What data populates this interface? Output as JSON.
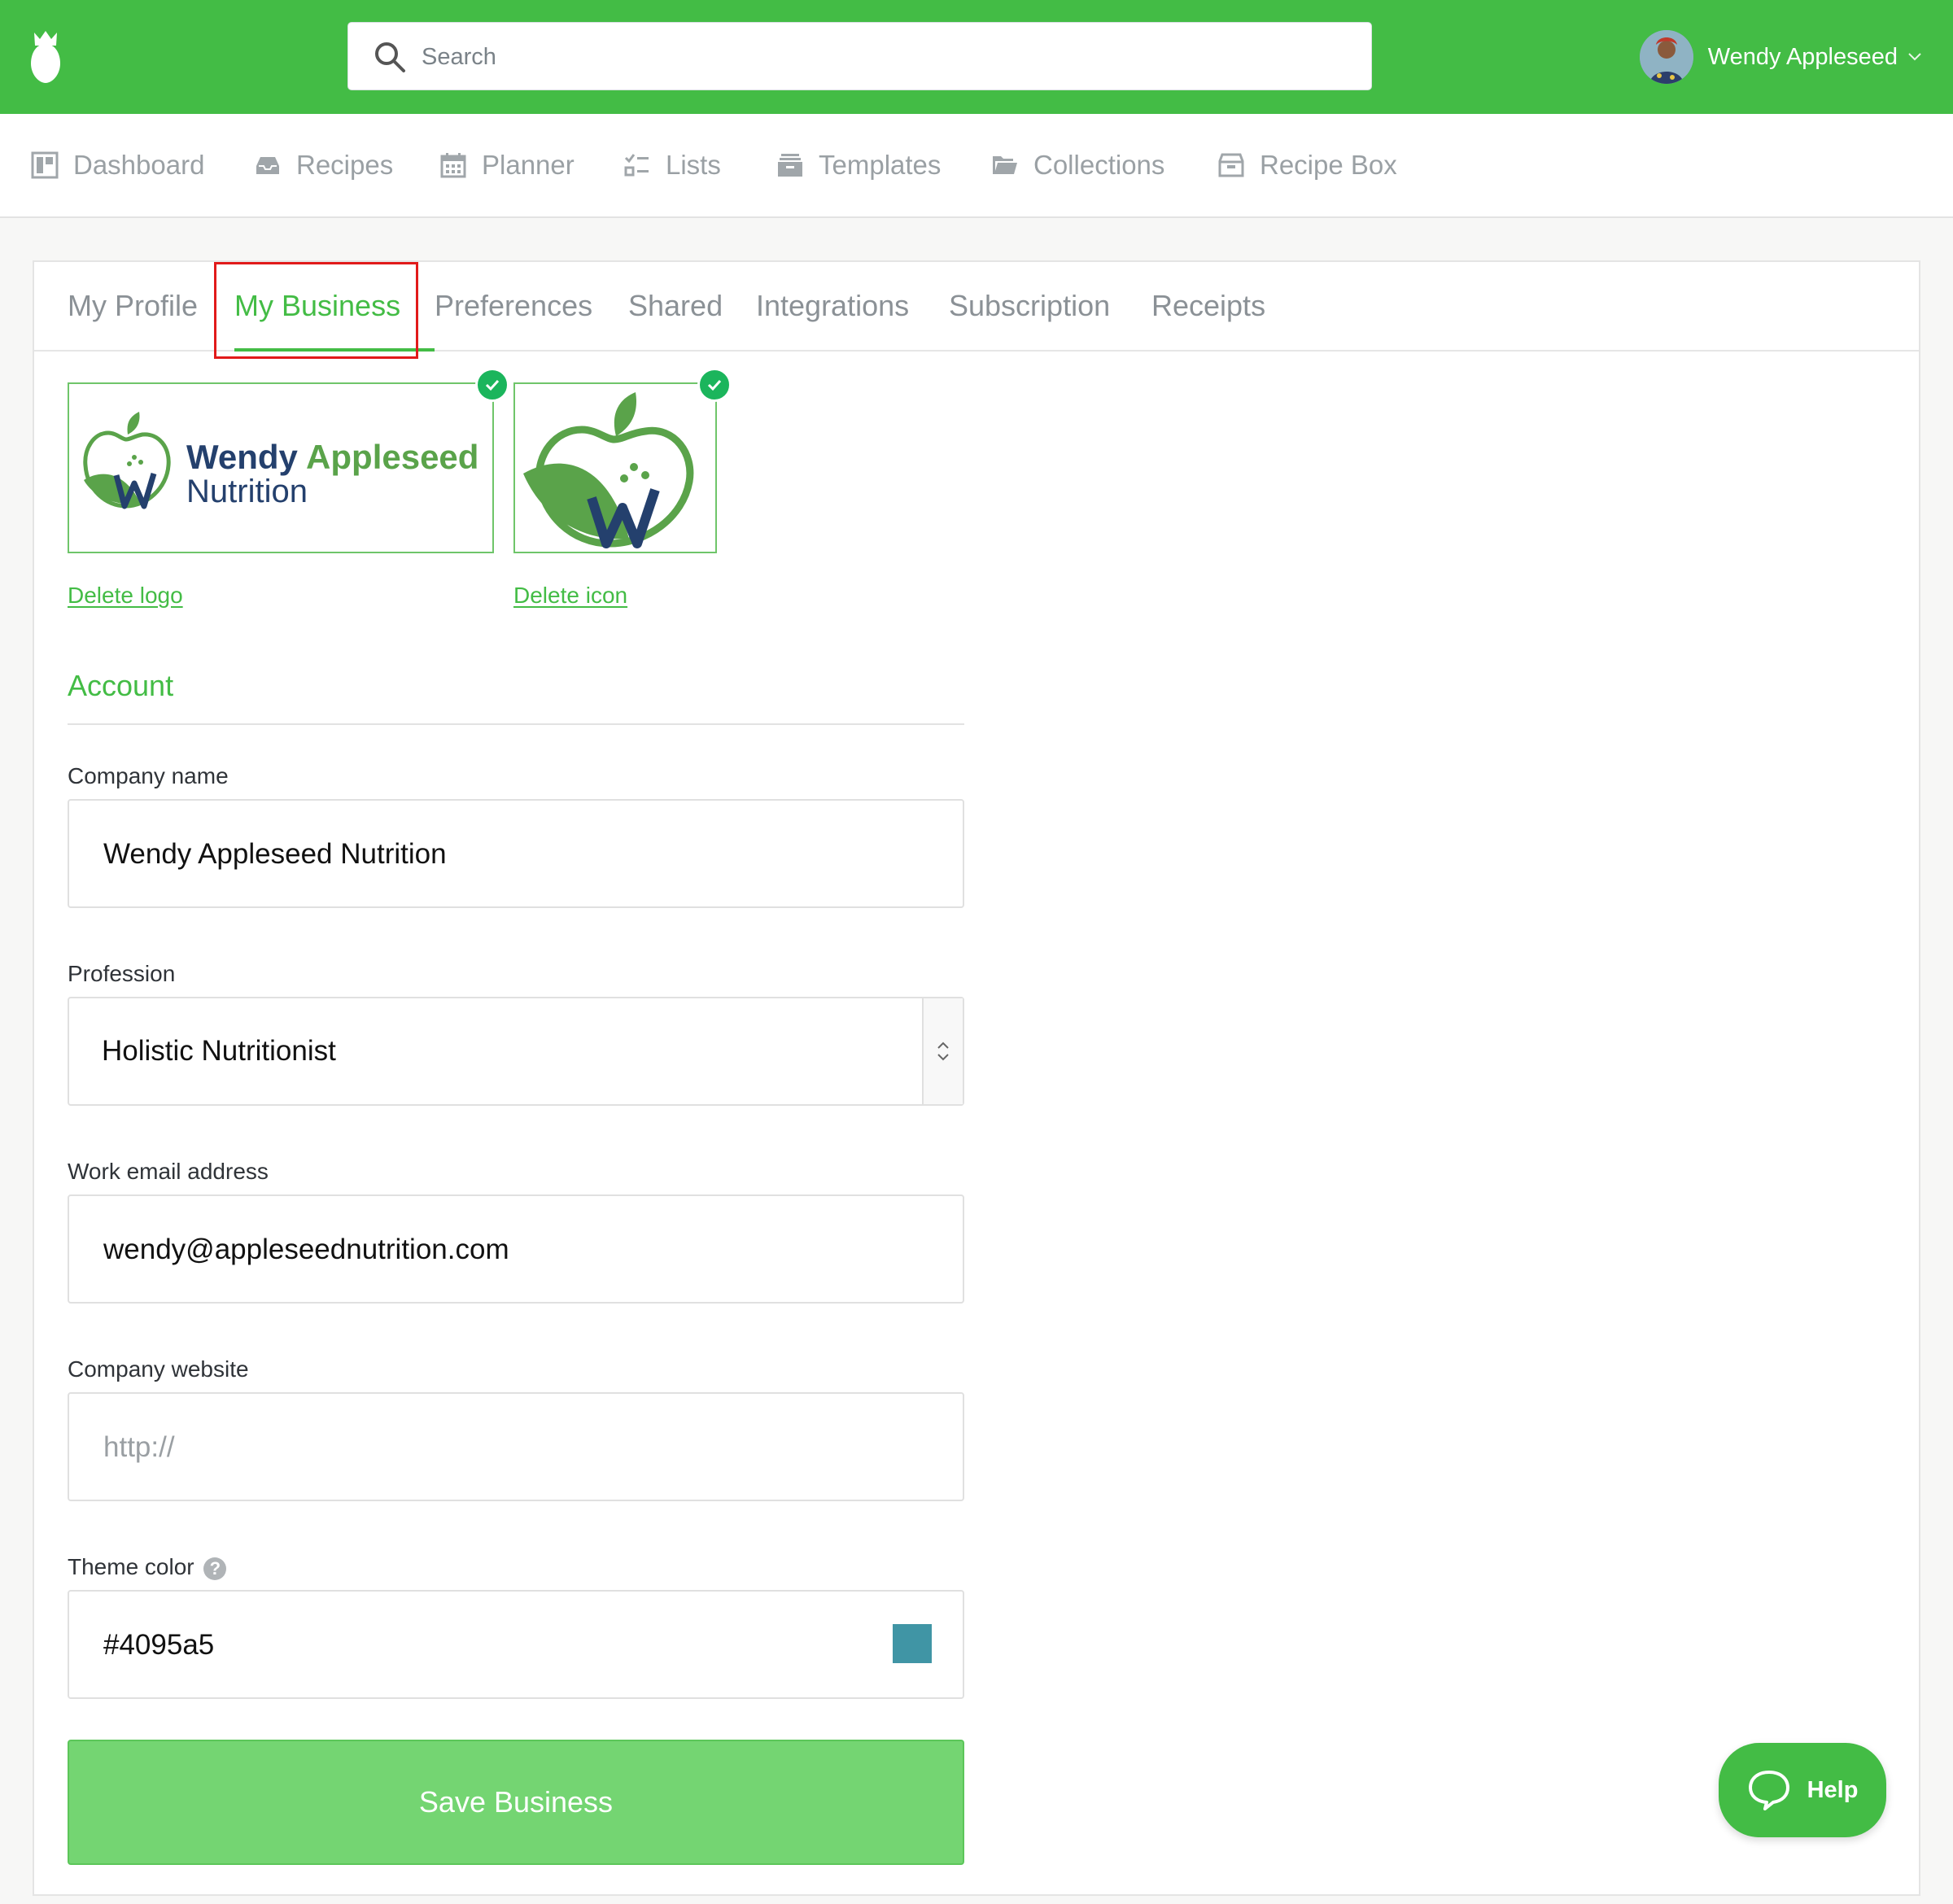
{
  "app": {
    "search_placeholder": "Search",
    "user_name": "Wendy Appleseed"
  },
  "nav": {
    "items": [
      {
        "label": "Dashboard",
        "icon": "dashboard-icon"
      },
      {
        "label": "Recipes",
        "icon": "inbox-icon"
      },
      {
        "label": "Planner",
        "icon": "calendar-icon"
      },
      {
        "label": "Lists",
        "icon": "checklist-icon"
      },
      {
        "label": "Templates",
        "icon": "archive-icon"
      },
      {
        "label": "Collections",
        "icon": "folder-icon"
      },
      {
        "label": "Recipe Box",
        "icon": "box-icon"
      }
    ]
  },
  "tabs": {
    "items": [
      "My Profile",
      "My Business",
      "Preferences",
      "Shared",
      "Integrations",
      "Subscription",
      "Receipts"
    ],
    "active": "My Business"
  },
  "branding": {
    "logo_text_line1_a": "Wendy",
    "logo_text_line1_b": "Appleseed",
    "logo_text_line2": "Nutrition",
    "delete_logo_label": "Delete logo",
    "delete_icon_label": "Delete icon"
  },
  "account": {
    "section_title": "Account",
    "company_name_label": "Company name",
    "company_name_value": "Wendy Appleseed Nutrition",
    "profession_label": "Profession",
    "profession_value": "Holistic Nutritionist",
    "email_label": "Work email address",
    "email_value": "wendy@appleseednutrition.com",
    "website_label": "Company website",
    "website_placeholder": "http://",
    "theme_color_label": "Theme color",
    "theme_color_help": "?",
    "theme_color_value": "#4095a5",
    "save_label": "Save Business"
  },
  "help": {
    "label": "Help"
  },
  "colors": {
    "brand": "#43bc45",
    "active_tab_outline": "#e11a1a",
    "theme_swatch": "#4095a5"
  }
}
